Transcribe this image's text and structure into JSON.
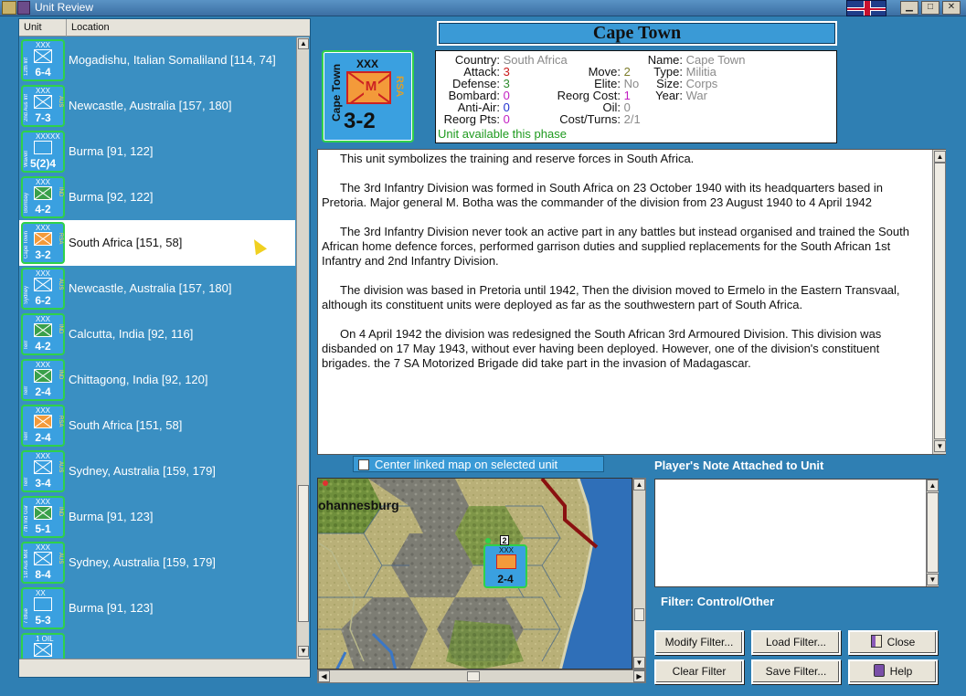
{
  "window": {
    "title": "Unit Review"
  },
  "list": {
    "col_unit": "Unit",
    "col_location": "Location",
    "rows": [
      {
        "size": "XXX",
        "strength": "6-4",
        "side": "12th Inf",
        "nation": "",
        "location": "Mogadishu, Italian Somaliland [114, 74]"
      },
      {
        "size": "XXX",
        "strength": "7-3",
        "side": "2nd Aus Inf",
        "nation": "AUS",
        "location": "Newcastle, Australia [157, 180]"
      },
      {
        "size": "XXXXX",
        "strength": "5(2)4",
        "side": "Wavell",
        "nation": "",
        "location": "Burma [91, 122]"
      },
      {
        "size": "XXX",
        "strength": "4-2",
        "side": "Bombay",
        "nation": "IND",
        "location": "Burma [92, 122]"
      },
      {
        "size": "XXX",
        "strength": "3-2",
        "side": "Cape Town",
        "nation": "RSA",
        "location": "South Africa [151, 58]"
      },
      {
        "size": "XXX",
        "strength": "6-2",
        "side": "Sydney",
        "nation": "AUS",
        "location": "Newcastle, Australia [157, 180]"
      },
      {
        "size": "XXX",
        "strength": "4-2",
        "side": "Terr",
        "nation": "IND",
        "location": "Calcutta, India [92, 116]"
      },
      {
        "size": "XXX",
        "strength": "2-4",
        "side": "Terr",
        "nation": "IND",
        "location": "Chittagong, India [92, 120]"
      },
      {
        "size": "XXX",
        "strength": "2-4",
        "side": "Terr",
        "nation": "RSA",
        "location": "South Africa [151, 58]"
      },
      {
        "size": "XXX",
        "strength": "3-4",
        "side": "Terr",
        "nation": "AUS",
        "location": "Sydney, Australia [159, 179]"
      },
      {
        "size": "XXX",
        "strength": "5-1",
        "side": "7th Ind Gar",
        "nation": "IND",
        "location": "Burma [91, 123]"
      },
      {
        "size": "XXX",
        "strength": "8-4",
        "side": "1st Aus Mot",
        "nation": "AUS",
        "location": "Sydney, Australia [159, 179]"
      },
      {
        "size": "XX",
        "strength": "5-3",
        "side": "7 Blue",
        "nation": "",
        "location": "Burma [91, 123]"
      },
      {
        "size": "1 OIL",
        "strength": "",
        "side": "",
        "nation": "",
        "location": ""
      }
    ]
  },
  "unit": {
    "name_title": "Cape Town",
    "counter": {
      "size": "XXX",
      "type_letter": "M",
      "strength": "3-2",
      "side_label": "Cape Town",
      "nation": "RSA"
    },
    "stats": {
      "country_label": "Country:",
      "country": "South Africa",
      "attack_label": "Attack:",
      "attack": "3",
      "defense_label": "Defense:",
      "defense": "3",
      "bombard_label": "Bombard:",
      "bombard": "0",
      "antiair_label": "Anti-Air:",
      "antiair": "0",
      "reorgpts_label": "Reorg Pts:",
      "reorgpts": "0",
      "move_label": "Move:",
      "move": "2",
      "elite_label": "Elite:",
      "elite": "No",
      "reorgcost_label": "Reorg Cost:",
      "reorgcost": "1",
      "oil_label": "Oil:",
      "oil": "0",
      "costturns_label": "Cost/Turns:",
      "costturns": "2/1",
      "name_label": "Name:",
      "name": "Cape Town",
      "type_label": "Type:",
      "type": "Militia",
      "size_label": "Size:",
      "size": "Corps",
      "year_label": "Year:",
      "year": "War",
      "availability": "Unit available this phase"
    },
    "description": [
      "This unit symbolizes the training and reserve forces in South Africa.",
      "The 3rd Infantry Division was formed in South Africa on 23 October 1940 with its headquarters based in Pretoria.  Major general M.  Botha was the commander of the division from 23 August 1940 to 4 April 1942",
      "The 3rd Infantry Division never took an active part in any battles but instead organised and trained the South African home defence forces, performed garrison duties and supplied replacements for the South African 1st Infantry and 2nd Infantry Division.",
      "The division was based in Pretoria until 1942, Then the division moved to Ermelo in the Eastern Transvaal, although its constituent units were deployed as far as the southwestern part of South Africa.",
      "On 4 April 1942 the division was redesigned the South African 3rd Armoured Division.  This division was disbanded on 17 May 1943, without ever having been deployed.  However, one of the division's constituent brigades. the 7 SA Motorized Brigade did take part in the invasion of Madagascar."
    ]
  },
  "map": {
    "center_label": "Center linked map on selected unit",
    "city_label": "ohannesburg",
    "counter": {
      "size": "XXX",
      "strength": "2-4",
      "stack": "2"
    }
  },
  "note": {
    "title": "Player's Note Attached to Unit",
    "text": ""
  },
  "filter": {
    "label": "Filter:  Control/Other"
  },
  "buttons": {
    "modify_filter": "Modify Filter...",
    "load_filter": "Load Filter...",
    "close": "Close",
    "clear_filter": "Clear Filter",
    "save_filter": "Save Filter...",
    "help": "Help"
  },
  "colors": {
    "panel_blue": "#2f7fb3",
    "counter_blue": "#3aa0e0",
    "counter_border": "#2fd14a",
    "militia_orange": "#f39a3a"
  }
}
